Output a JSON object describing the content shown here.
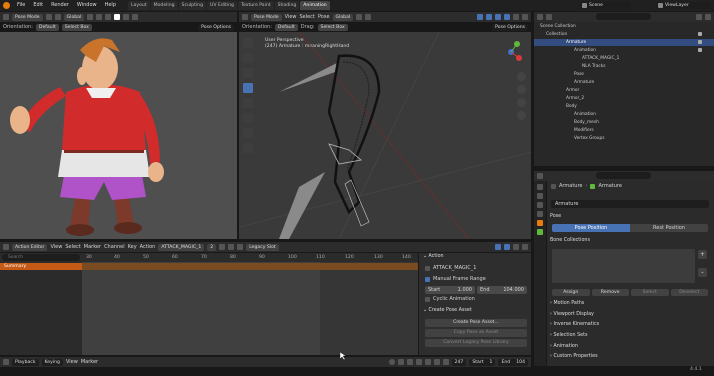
{
  "topbar": {
    "menus": [
      "File",
      "Edit",
      "Render",
      "Window",
      "Help"
    ],
    "workspaces": [
      "Layout",
      "Modeling",
      "Sculpting",
      "UV Editing",
      "Texture Paint",
      "Shading",
      "Animation"
    ],
    "active_workspace": "Animation",
    "scene": "Scene",
    "view_layer": "ViewLayer"
  },
  "left_viewport": {
    "mode": "Pose Mode",
    "transform": "Global",
    "orientation_label": "Orientation:",
    "orientation": "Default",
    "select_box": "Select Box",
    "pose_options": "Pose Options"
  },
  "right_viewport": {
    "mode": "Pose Mode",
    "menus": [
      "View",
      "Select",
      "Pose"
    ],
    "transform": "Global",
    "orientation_label": "Orientation:",
    "orientation": "Default",
    "drag_label": "Drag:",
    "select_box": "Select Box",
    "pose_options": "Pose Options",
    "perspective": "User Perspective",
    "subtitle": "(247) Armature : meaningRightHand"
  },
  "outliner": {
    "search_placeholder": "",
    "items": [
      {
        "label": "Scene Collection",
        "indent": 0
      },
      {
        "label": "Collection",
        "indent": 1
      },
      {
        "label": "Armature",
        "indent": 2,
        "selected": true
      },
      {
        "label": "Animation",
        "indent": 3
      },
      {
        "label": "ATTACK_MAGIC_1",
        "indent": 4
      },
      {
        "label": "NLA Tracks",
        "indent": 4
      },
      {
        "label": "Pose",
        "indent": 3
      },
      {
        "label": "Armature",
        "indent": 3
      },
      {
        "label": "Armor",
        "indent": 2
      },
      {
        "label": "Armor_2",
        "indent": 2
      },
      {
        "label": "Body",
        "indent": 2
      },
      {
        "label": "Animation",
        "indent": 3
      },
      {
        "label": "Body_mesh",
        "indent": 3
      },
      {
        "label": "Modifiers",
        "indent": 3
      },
      {
        "label": "Vertex Groups",
        "indent": 3
      }
    ]
  },
  "properties": {
    "breadcrumb_object": "Armature",
    "breadcrumb_data": "Armature",
    "data_name": "Armature",
    "pose_section": "Pose",
    "pose_position": "Pose Position",
    "rest_position": "Rest Position",
    "bone_collections": "Bone Collections",
    "assign": "Assign",
    "remove": "Remove",
    "select": "Select",
    "deselect": "Deselect",
    "sections": [
      "Motion Paths",
      "Viewport Display",
      "Inverse Kinematics",
      "Selection Sets",
      "Animation",
      "Custom Properties"
    ]
  },
  "action_editor": {
    "mode": "Action Editor",
    "menus": [
      "View",
      "Select",
      "Marker",
      "Channel",
      "Key",
      "Action"
    ],
    "action_name": "ATTACK_MAGIC_1",
    "users": "2",
    "slot": "Legacy Slot",
    "search_placeholder": "Search",
    "summary": "Summary",
    "ticks": [
      "30",
      "40",
      "50",
      "60",
      "70",
      "80",
      "90",
      "100",
      "110",
      "120",
      "130",
      "140"
    ]
  },
  "action_panel": {
    "header": "Action",
    "action_name": "ATTACK_MAGIC_1",
    "manual_frame_range": "Manual Frame Range",
    "start_label": "Start",
    "start_value": "1.000",
    "end_label": "End",
    "end_value": "104.000",
    "cyclic": "Cyclic Animation",
    "create_pose_asset_header": "Create Pose Asset",
    "create_pose_asset": "Create Pose Asset...",
    "copy_pose_asset": "Copy Pose as Asset",
    "convert_legacy": "Convert Legacy Pose Library"
  },
  "timeline": {
    "menus": [
      "Playback",
      "Keying",
      "View",
      "Marker"
    ],
    "current_frame": "247",
    "start_label": "Start",
    "start_value": "1",
    "end_label": "End",
    "end_value": "104"
  },
  "status": {
    "version": "4.4.1"
  }
}
